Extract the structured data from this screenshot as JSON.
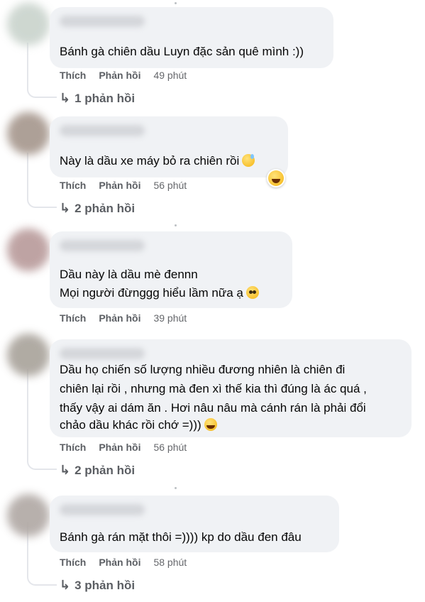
{
  "comments": [
    {
      "text_lines": [
        "Bánh gà chiên dầu Luyn đặc sản quê mình :))"
      ],
      "like": "Thích",
      "reply": "Phản hồi",
      "time": "49 phút",
      "replies_label": "1 phản hồi",
      "avatar_color": "#c9d3cc"
    },
    {
      "text_lines": [
        "Này là dầu xe máy bỏ ra chiên rồi"
      ],
      "like": "Thích",
      "reply": "Phản hồi",
      "time": "56 phút",
      "replies_label": "2 phản hồi",
      "avatar_color": "#a5968c"
    },
    {
      "text_lines": [
        "Dầu này là dầu mè đennn",
        "Mọi người đừnggg hiểu lầm nữa ạ"
      ],
      "like": "Thích",
      "reply": "Phản hồi",
      "time": "39 phút",
      "avatar_color": "#b89a9a"
    },
    {
      "text_lines": [
        "Dầu họ chiến số lượng nhiều đương nhiên là chiên đi",
        "chiên lại rồi , nhưng mà đen xì thế kia thì đúng là ác quá ,",
        "thấy vậy ai dám ăn . Hơi nâu nâu mà cánh rán là phải đổi",
        "chảo dầu khác rồi chớ =)))"
      ],
      "like": "Thích",
      "reply": "Phản hồi",
      "time": "56 phút",
      "replies_label": "2 phản hồi",
      "avatar_color": "#a8a29a"
    },
    {
      "text_lines": [
        "Bánh gà rán mặt thôi =)))) kp do dầu đen đâu"
      ],
      "like": "Thích",
      "reply": "Phản hồi",
      "time": "58 phút",
      "replies_label": "3 phản hồi",
      "avatar_color": "#b0a8a4"
    }
  ]
}
